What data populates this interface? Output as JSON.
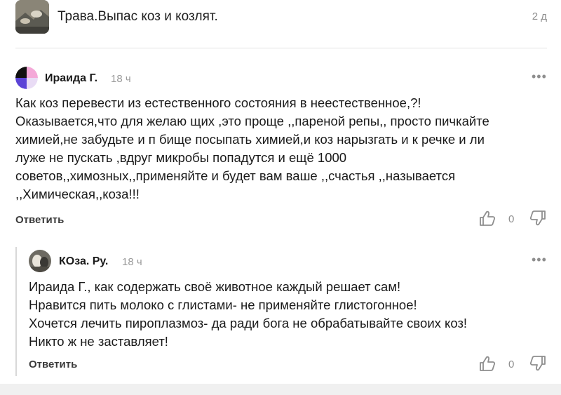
{
  "post": {
    "title": "Трава.Выпас коз и козлят.",
    "time": "2 д"
  },
  "comments": [
    {
      "author": "Ираида Г.",
      "time": "18 ч",
      "text": "Как коз перевести из естественного состояния в неестественное,?!\nОказывается,что для желаю щих ,это проще ,,пареной репы,, просто пичкайте\nхимией,не забудьте  и п бище посыпать химией,и коз нарызгать и к речке и ли\nлуже не пускать ,вдруг микробы попадутся и ещё 1000\nсоветов,,химозных,,применяйте и будет вам ваше ,,счастья ,,называется\n,,Химическая,,коза!!!",
      "reply_label": "Ответить",
      "likes": "0",
      "more_label": "•••"
    },
    {
      "author": "КОза. Ру.",
      "time": "18 ч",
      "text": "Ираида Г., как содержать своё животное каждый решает сам!\nНравится пить молоко с глистами- не применяйте глистогонное!\nХочется лечить пироплазмоз- да ради бога не обрабатывайте своих коз!\nНикто ж не заставляет!",
      "reply_label": "Ответить",
      "likes": "0",
      "more_label": "•••"
    }
  ],
  "colors": {
    "text": "#1a1a1a",
    "muted": "#8e8e8e",
    "divider": "#e3e3e3"
  },
  "icons": [
    "thumb-up-icon",
    "thumb-down-icon",
    "more-dots-icon"
  ]
}
